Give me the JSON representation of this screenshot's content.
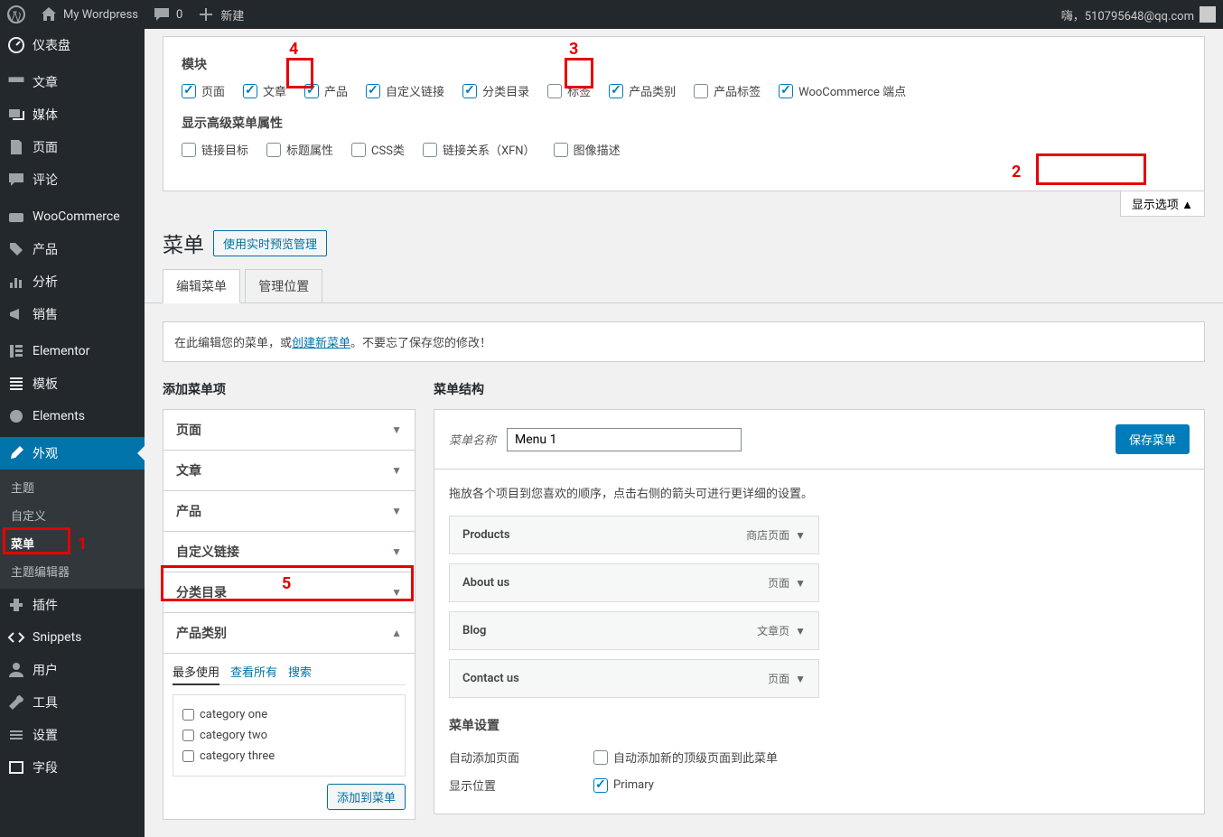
{
  "adminbar": {
    "site": "My Wordpress",
    "comments": "0",
    "new": "新建",
    "greeting": "嗨，510795648@qq.com"
  },
  "sidebar": {
    "items": [
      {
        "label": "仪表盘"
      },
      {
        "label": "文章"
      },
      {
        "label": "媒体"
      },
      {
        "label": "页面"
      },
      {
        "label": "评论"
      },
      {
        "label": "WooCommerce"
      },
      {
        "label": "产品"
      },
      {
        "label": "分析"
      },
      {
        "label": "销售"
      },
      {
        "label": "Elementor"
      },
      {
        "label": "模板"
      },
      {
        "label": "Elements"
      },
      {
        "label": "外观"
      },
      {
        "label": "插件"
      },
      {
        "label": "Snippets"
      },
      {
        "label": "用户"
      },
      {
        "label": "工具"
      },
      {
        "label": "设置"
      },
      {
        "label": "字段"
      }
    ],
    "submenu": {
      "items": [
        {
          "label": "主题"
        },
        {
          "label": "自定义"
        },
        {
          "label": "菜单"
        },
        {
          "label": "主题编辑器"
        }
      ]
    }
  },
  "screenOptions": {
    "modulesTitle": "模块",
    "modules": [
      {
        "label": "页面",
        "checked": true
      },
      {
        "label": "文章",
        "checked": true
      },
      {
        "label": "产品",
        "checked": true
      },
      {
        "label": "自定义链接",
        "checked": true
      },
      {
        "label": "分类目录",
        "checked": true
      },
      {
        "label": "标签",
        "checked": false
      },
      {
        "label": "产品类别",
        "checked": true
      },
      {
        "label": "产品标签",
        "checked": false
      },
      {
        "label": "WooCommerce 端点",
        "checked": true
      }
    ],
    "advancedTitle": "显示高级菜单属性",
    "advanced": [
      {
        "label": "链接目标",
        "checked": false
      },
      {
        "label": "标题属性",
        "checked": false
      },
      {
        "label": "CSS类",
        "checked": false
      },
      {
        "label": "链接关系（XFN）",
        "checked": false
      },
      {
        "label": "图像描述",
        "checked": false
      }
    ],
    "toggle": "显示选项"
  },
  "page": {
    "title": "菜单",
    "livePreview": "使用实时预览管理"
  },
  "tabs": {
    "edit": "编辑菜单",
    "manage": "管理位置"
  },
  "notice": {
    "prefix": "在此编辑您的菜单，或",
    "link": "创建新菜单",
    "suffix": "。不要忘了保存您的修改！"
  },
  "addItems": {
    "title": "添加菜单项",
    "panels": [
      {
        "label": "页面"
      },
      {
        "label": "文章"
      },
      {
        "label": "产品"
      },
      {
        "label": "自定义链接"
      },
      {
        "label": "分类目录"
      },
      {
        "label": "产品类别"
      }
    ],
    "innerTabs": {
      "most": "最多使用",
      "all": "查看所有",
      "search": "搜索"
    },
    "categories": [
      {
        "label": "category one"
      },
      {
        "label": "category two"
      },
      {
        "label": "category three"
      }
    ],
    "addToMenu": "添加到菜单"
  },
  "structure": {
    "title": "菜单结构",
    "nameLabel": "菜单名称",
    "nameValue": "Menu 1",
    "save": "保存菜单",
    "hint": "拖放各个项目到您喜欢的顺序，点击右侧的箭头可进行更详细的设置。",
    "items": [
      {
        "title": "Products",
        "type": "商店页面"
      },
      {
        "title": "About us",
        "type": "页面"
      },
      {
        "title": "Blog",
        "type": "文章页"
      },
      {
        "title": "Contact us",
        "type": "页面"
      }
    ],
    "settingsTitle": "菜单设置",
    "autoAddLabel": "自动添加页面",
    "autoAddOption": "自动添加新的顶级页面到此菜单",
    "displayLabel": "显示位置",
    "displayOption": "Primary"
  },
  "annotations": {
    "n1": "1",
    "n2": "2",
    "n3": "3",
    "n4": "4",
    "n5": "5"
  }
}
